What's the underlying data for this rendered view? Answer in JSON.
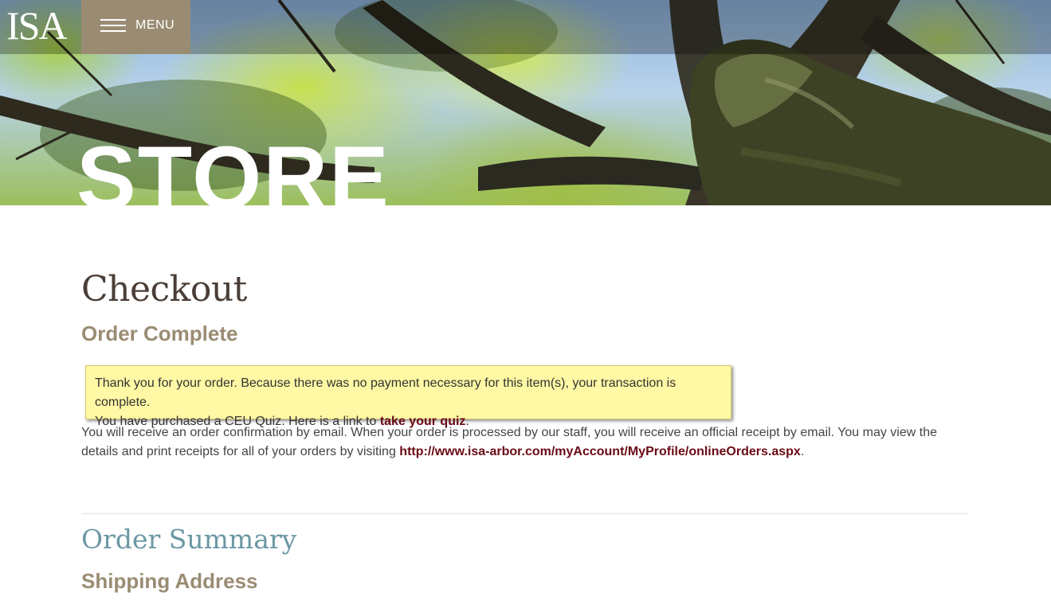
{
  "header": {
    "logo_text": "ISA",
    "menu_label": "MENU",
    "hero_title": "STORE"
  },
  "main": {
    "page_title": "Checkout",
    "order_status_heading": "Order Complete",
    "notice": {
      "line1": "Thank you for your order. Because there was no payment necessary for this item(s), your transaction is complete.",
      "line2_prefix": "You have purchased a CEU Quiz. Here is a link to ",
      "quiz_link_label": "take your quiz",
      "line2_suffix": "."
    },
    "confirmation": {
      "text_prefix": "You will receive an order confirmation by email. When your order is processed by our staff, you will receive an official receipt by email. You may view the details and print receipts for all of your orders by visiting ",
      "orders_link_label": "http://www.isa-arbor.com/myAccount/MyProfile/onlineOrders.aspx",
      "text_suffix": "."
    },
    "order_summary_heading": "Order Summary",
    "shipping_address_heading": "Shipping Address"
  },
  "colors": {
    "menu_bg": "#9a8c73",
    "heading_tan": "#9a8c73",
    "summary_teal": "#6b98a3",
    "link_maroon": "#6a0a14",
    "notice_bg": "#fff8a4"
  },
  "icons": {
    "menu": "hamburger-icon"
  }
}
